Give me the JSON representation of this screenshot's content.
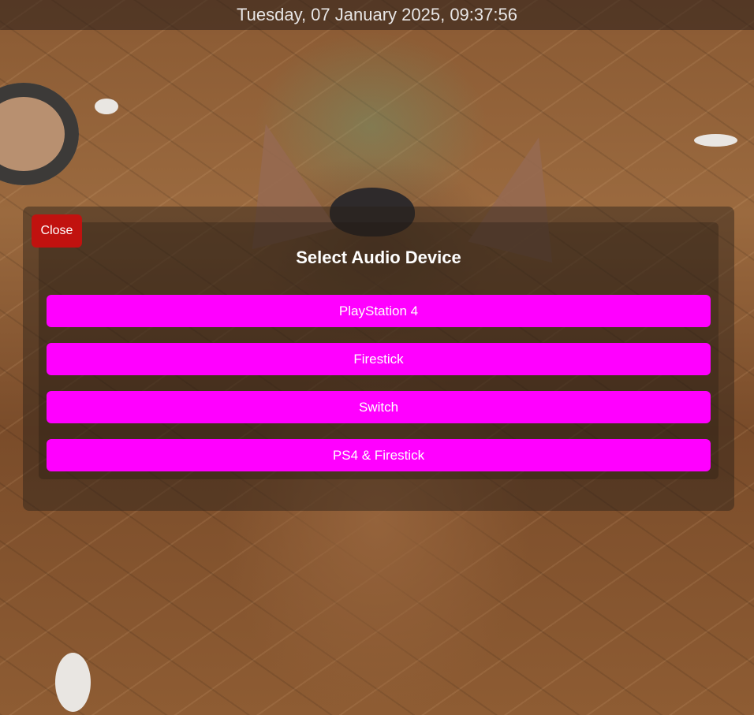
{
  "datetime": "Tuesday, 07 January 2025, 09:37:56",
  "modal": {
    "close_label": "Close",
    "title": "Select Audio Device",
    "devices": [
      {
        "label": "PlayStation 4"
      },
      {
        "label": "Firestick"
      },
      {
        "label": "Switch"
      },
      {
        "label": "PS4 & Firestick"
      }
    ]
  },
  "colors": {
    "device_button": "#ff00ff",
    "close_button": "#c1120f"
  }
}
